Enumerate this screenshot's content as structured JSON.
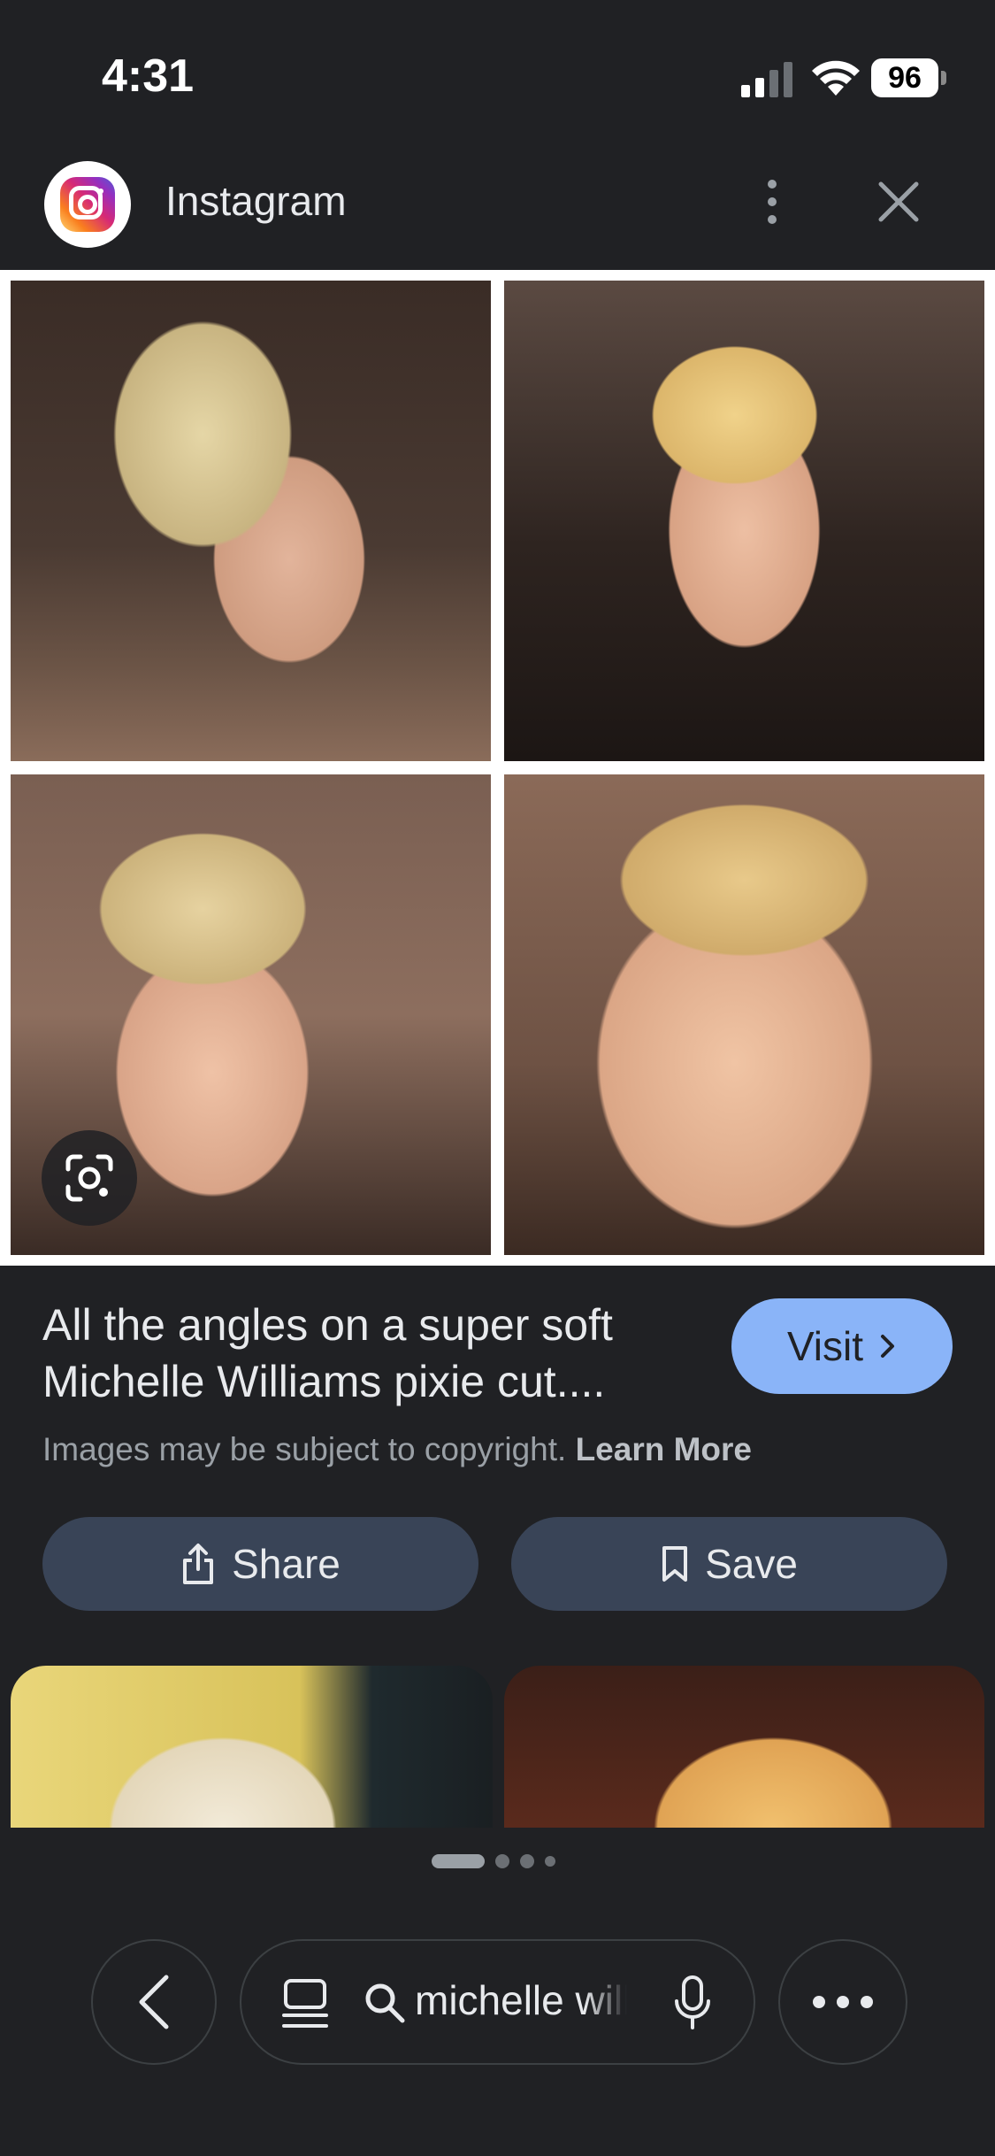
{
  "status_bar": {
    "time": "4:31",
    "battery": "96"
  },
  "header": {
    "source_name": "Instagram",
    "source_icon": "instagram-logo",
    "menu_icon": "more-vert-icon",
    "close_icon": "close-icon"
  },
  "image": {
    "lens_icon": "google-lens-icon"
  },
  "caption": {
    "title": "All the angles on a super soft Michelle Williams pixie cut....",
    "visit_label": "Visit",
    "copyright_text": "Images may be subject to copyright.",
    "learn_more": "Learn More"
  },
  "actions": {
    "share_label": "Share",
    "save_label": "Save"
  },
  "pager": {
    "pages": 4,
    "active_index": 0
  },
  "bottom_bar": {
    "search_query": "michelle williams pixie",
    "back_icon": "chevron-left-icon",
    "tabs_icon": "tabs-icon",
    "search_icon": "search-icon",
    "mic_icon": "mic-icon",
    "more_icon": "more-horiz-icon"
  },
  "colors": {
    "background": "#202124",
    "accent": "#8ab4f8",
    "button_bg": "#394457"
  }
}
